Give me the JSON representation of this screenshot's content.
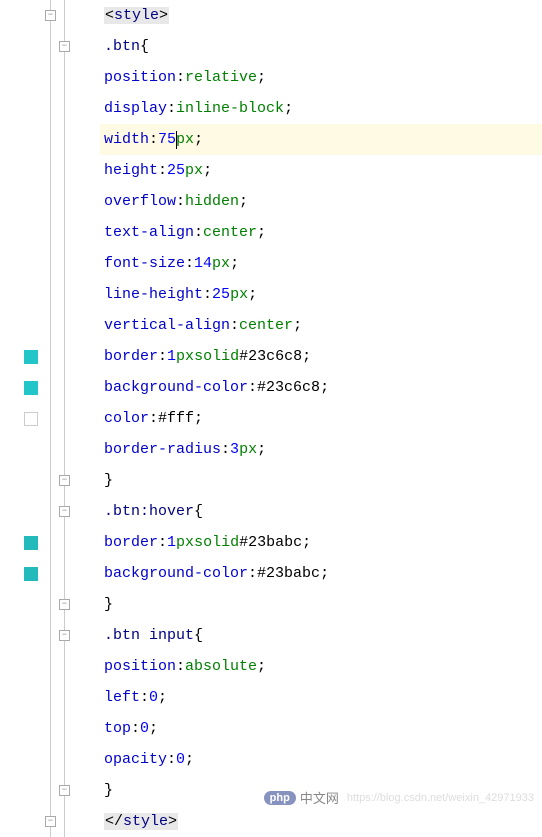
{
  "code": {
    "lines": [
      {
        "indent": 0,
        "type": "tag-open",
        "tag": "style",
        "fold": "open-outer"
      },
      {
        "indent": 1,
        "type": "selector",
        "text": ".btn{",
        "fold": "open-inner"
      },
      {
        "indent": 2,
        "type": "decl",
        "prop": "position",
        "val": "relative"
      },
      {
        "indent": 2,
        "type": "decl",
        "prop": "display",
        "val": "inline-block"
      },
      {
        "indent": 2,
        "type": "decl",
        "prop": "width",
        "num": "75",
        "unit": "px",
        "hl": true,
        "caret": true
      },
      {
        "indent": 2,
        "type": "decl",
        "prop": "height",
        "num": "25",
        "unit": "px"
      },
      {
        "indent": 2,
        "type": "decl",
        "prop": "overflow",
        "val": "hidden"
      },
      {
        "indent": 2,
        "type": "decl",
        "prop": "text-align",
        "val": "center"
      },
      {
        "indent": 2,
        "type": "decl",
        "prop": "font-size",
        "num": "14",
        "unit": "px"
      },
      {
        "indent": 2,
        "type": "decl",
        "prop": "line-height",
        "num": "25",
        "unit": "px"
      },
      {
        "indent": 2,
        "type": "decl",
        "prop": "vertical-align",
        "val": "center"
      },
      {
        "indent": 2,
        "type": "decl",
        "prop": "border",
        "raw": "1px solid #23c6c8",
        "swatch": "teal"
      },
      {
        "indent": 2,
        "type": "decl",
        "prop": "background-color",
        "hex": "#23c6c8",
        "swatch": "teal"
      },
      {
        "indent": 2,
        "type": "decl",
        "prop": "color",
        "hex": "#fff",
        "nospace": true,
        "swatch": "white"
      },
      {
        "indent": 2,
        "type": "decl",
        "prop": "border-radius",
        "num": "3",
        "unit": "px"
      },
      {
        "indent": 1,
        "type": "brace-close",
        "fold": "close-inner"
      },
      {
        "indent": 1,
        "type": "selector",
        "text": ".btn:hover{",
        "fold": "open-inner"
      },
      {
        "indent": 2,
        "type": "decl",
        "prop": "border",
        "raw": "1px solid #23babc",
        "swatch": "teal2"
      },
      {
        "indent": 2,
        "type": "decl",
        "prop": "background-color",
        "hex": "#23babc",
        "swatch": "teal2"
      },
      {
        "indent": 1,
        "type": "brace-close",
        "fold": "close-inner"
      },
      {
        "indent": 1,
        "type": "selector",
        "text": ".btn input{",
        "fold": "open-inner"
      },
      {
        "indent": 2,
        "type": "decl",
        "prop": "position",
        "val": "absolute"
      },
      {
        "indent": 2,
        "type": "decl",
        "prop": "left",
        "num": "0"
      },
      {
        "indent": 2,
        "type": "decl",
        "prop": "top",
        "num": "0"
      },
      {
        "indent": 2,
        "type": "decl",
        "prop": "opacity",
        "num": "0"
      },
      {
        "indent": 1,
        "type": "brace-close",
        "fold": "close-inner"
      },
      {
        "indent": 0,
        "type": "tag-close",
        "tag": "style",
        "fold": "close-outer"
      }
    ]
  },
  "watermark": {
    "badge": "php",
    "cn": "中文网",
    "url": "https://blog.csdn.net/weixin_42971933"
  }
}
